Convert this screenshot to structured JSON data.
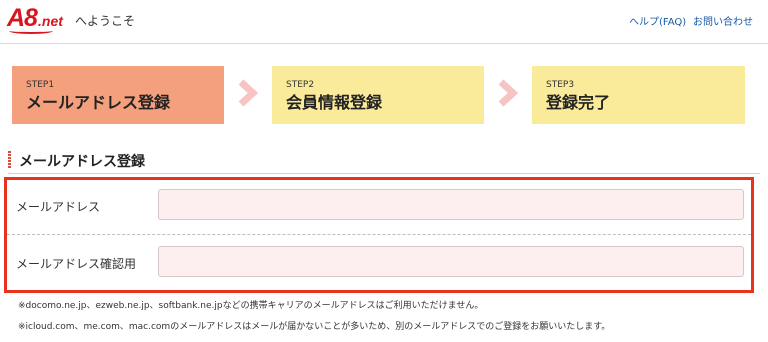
{
  "header": {
    "logo_main": "A8",
    "logo_suffix": ".net",
    "welcome": "へようこそ",
    "help_link": "ヘルプ(FAQ)",
    "contact_link": "お問い合わせ"
  },
  "steps": [
    {
      "number": "STEP1",
      "title": "メールアドレス登録",
      "status": "current",
      "color": "#f5a07d"
    },
    {
      "number": "STEP2",
      "title": "会員情報登録",
      "status": "upcoming",
      "color": "#faeb9b"
    },
    {
      "number": "STEP3",
      "title": "登録完了",
      "status": "upcoming",
      "color": "#faeb9b"
    }
  ],
  "section": {
    "title": "メールアドレス登録"
  },
  "form": {
    "email_label": "メールアドレス",
    "email_value": "",
    "confirm_label": "メールアドレス確認用",
    "confirm_value": ""
  },
  "notes": [
    "※docomo.ne.jp、ezweb.ne.jp、softbank.ne.jpなどの携帯キャリアのメールアドレスはご利用いただけません。",
    "※icloud.com、me.com、mac.comのメールアドレスはメールが届かないことが多いため、別のメールアドレスでのご登録をお願いいたします。"
  ],
  "icons": {
    "step_arrow": "chevron-right-icon",
    "section_marker": "section-bar-icon"
  },
  "colors": {
    "brand": "#d7171f",
    "link": "#1a5aa6",
    "highlight_border": "#e8321f",
    "input_bg": "#fdeef0",
    "arrow": "#f7c4c4"
  }
}
